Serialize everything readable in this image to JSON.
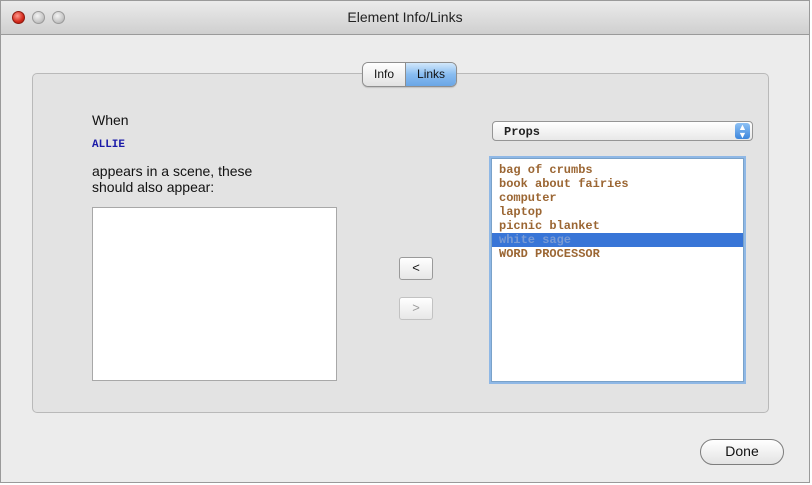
{
  "window": {
    "title": "Element Info/Links"
  },
  "tabs": [
    {
      "label": "Info",
      "selected": false
    },
    {
      "label": "Links",
      "selected": true
    }
  ],
  "left_pane": {
    "when_label": "When",
    "element_name": "ALLIE",
    "description_line1": "appears in a scene, these",
    "description_line2": "should also appear:",
    "linked_items": []
  },
  "buttons": {
    "add_label": "<",
    "remove_label": ">",
    "done_label": "Done"
  },
  "category_select": {
    "value": "Props",
    "arrow_glyph": "▲▼"
  },
  "available_items": [
    {
      "label": "bag of crumbs",
      "selected": false
    },
    {
      "label": "book about fairies",
      "selected": false
    },
    {
      "label": "computer",
      "selected": false
    },
    {
      "label": "laptop",
      "selected": false
    },
    {
      "label": "picnic blanket",
      "selected": false
    },
    {
      "label": "white sage",
      "selected": true
    },
    {
      "label": "WORD PROCESSOR",
      "selected": false
    }
  ],
  "colors": {
    "element_name": "#1a1aa8",
    "list_text": "#9b6633",
    "selection": "#3875d7",
    "tab_selected": "#88bcf0"
  }
}
